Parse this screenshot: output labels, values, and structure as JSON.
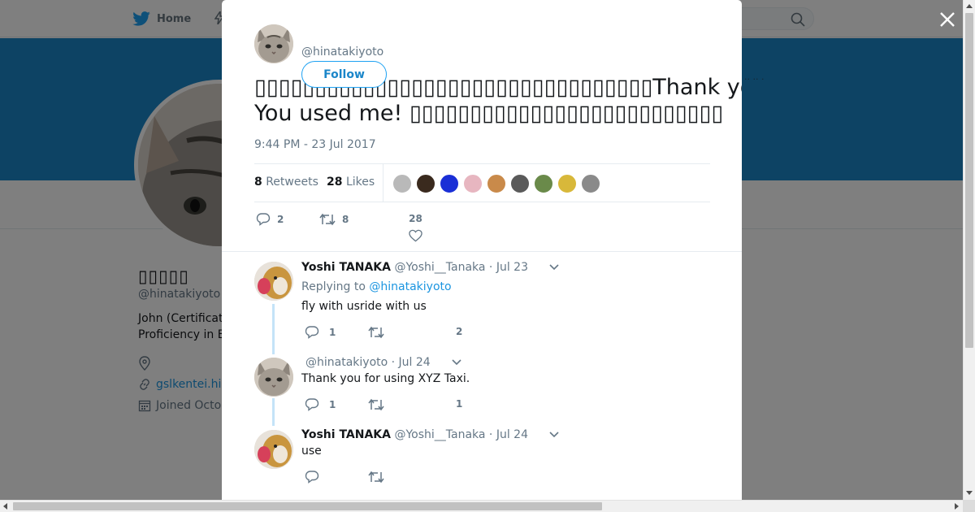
{
  "nav": {
    "home_label": "Home",
    "banner_text": "·· ·· ·"
  },
  "profile": {
    "name": "▯▯▯▯▯",
    "handle": "@hinatakiyoto",
    "bio_line1": "John (Certificat",
    "bio_line2": "Proficiency in E",
    "link": "gslkentei.hi",
    "joined": "Joined Octo"
  },
  "tweet": {
    "handle": "@hinatakiyoto",
    "follow_label": "Follow",
    "text_line1": "▯▯▯▯▯▯▯▯▯▯▯▯▯▯▯▯▯▯▯▯▯▯▯▯▯▯▯▯▯▯▯▯▯Thank you for using us.▯",
    "text_line2": "You used me! ▯▯▯▯▯▯▯▯▯▯▯▯▯▯▯▯▯▯▯▯▯▯▯▯▯▯",
    "time": "9:44 PM - 23 Jul 2017",
    "retweets_count": "8",
    "retweets_label": "Retweets",
    "likes_count": "28",
    "likes_label": "Likes",
    "reply_count": "2",
    "retweet_count": "8",
    "like_count": "28"
  },
  "likers": [
    {
      "color": "#b9b9b9",
      "icon": "avatar-moon"
    },
    {
      "color": "#3a2a1e",
      "icon": "avatar-person"
    },
    {
      "color": "#1a2fd6",
      "icon": "avatar-blue"
    },
    {
      "color": "#e7b6c0",
      "icon": "avatar-pink"
    },
    {
      "color": "#c98a4a",
      "icon": "avatar-face"
    },
    {
      "color": "#5a5a5a",
      "icon": "avatar-dark"
    },
    {
      "color": "#6a8a4a",
      "icon": "avatar-panda"
    },
    {
      "color": "#d8b83a",
      "icon": "avatar-colorful"
    },
    {
      "color": "#8a8a8a",
      "icon": "avatar-gray"
    }
  ],
  "replies": [
    {
      "name": "Yoshi TANAKA",
      "handle": "@Yoshi__Tanaka",
      "date": "· Jul 23",
      "replying_prefix": "Replying to ",
      "replying_to": "@hinatakiyoto",
      "text": "fly with usride with us",
      "reply_count": "1",
      "like_count": "2"
    },
    {
      "name": "",
      "handle": "@hinatakiyoto",
      "date": "· Jul 24",
      "text": "Thank you for using XYZ Taxi.",
      "reply_count": "1",
      "like_count": "1"
    },
    {
      "name": "Yoshi TANAKA",
      "handle": "@Yoshi__Tanaka",
      "date": "· Jul 24",
      "text": "use",
      "reply_count": "",
      "like_count": ""
    }
  ],
  "colors": {
    "brand": "#1da1f2",
    "banner": "#1b86c9",
    "link": "#1b95e0"
  }
}
